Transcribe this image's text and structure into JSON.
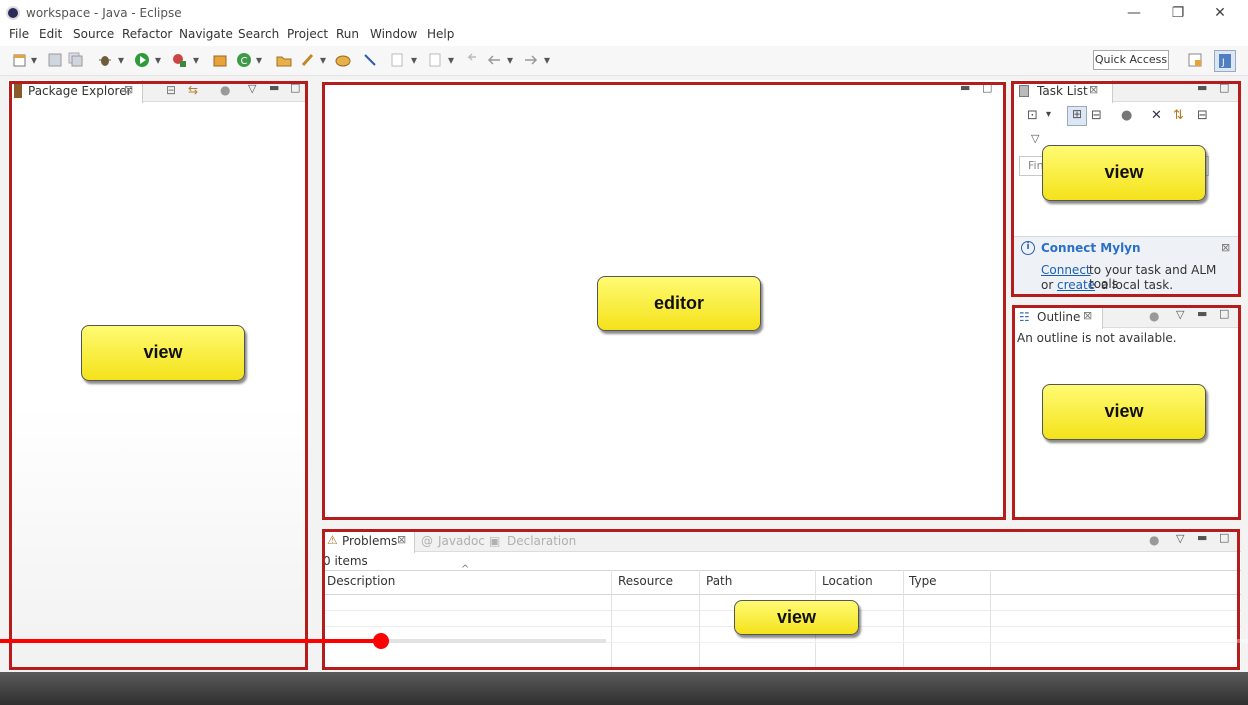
{
  "window": {
    "title": "workspace - Java - Eclipse",
    "minimize_glyph": "—",
    "restore_glyph": "❐",
    "close_glyph": "✕"
  },
  "menu": [
    "File",
    "Edit",
    "Source",
    "Refactor",
    "Navigate",
    "Search",
    "Project",
    "Run",
    "Window",
    "Help"
  ],
  "toolbar": {
    "quick_access": "Quick Access"
  },
  "package_explorer": {
    "tab_label": "Package Explorer"
  },
  "task_list": {
    "tab_label": "Task List",
    "find_placeholder": "Fin"
  },
  "mylyn": {
    "title": "Connect Mylyn",
    "connect_link": "Connect",
    "line1_rest": "to your task and ALM tools",
    "line2_prefix": "or",
    "create_link": "create",
    "line2_rest": "a local task."
  },
  "outline": {
    "tab_label": "Outline",
    "empty_message": "An outline is not available."
  },
  "problems": {
    "tab_label": "Problems",
    "javadoc_tab": "Javadoc",
    "declaration_tab": "Declaration",
    "items_count": "0 items",
    "columns": [
      "Description",
      "Resource",
      "Path",
      "Location",
      "Type"
    ]
  },
  "callouts": {
    "left_view": "view",
    "editor": "editor",
    "tasklist_view": "view",
    "outline_view": "view",
    "problems_view": "view"
  },
  "video_progress": 0.305,
  "colors": {
    "frame": "#b71c1c",
    "callout": "#fff200",
    "progress": "#ff0000"
  }
}
